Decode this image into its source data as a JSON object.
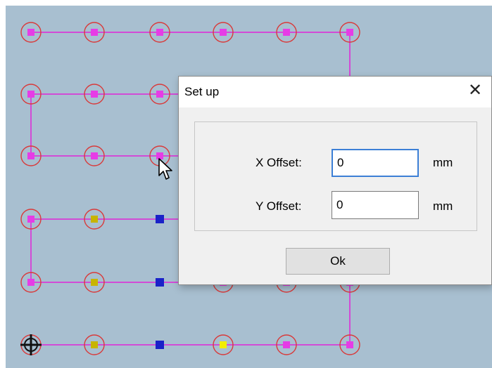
{
  "dialog": {
    "title": "Set up",
    "close_glyph": "✕",
    "x_offset_label": "X Offset:",
    "x_offset_value": "0",
    "x_offset_unit": "mm",
    "y_offset_label": "Y Offset:",
    "y_offset_value": "0",
    "y_offset_unit": "mm",
    "ok_label": "Ok"
  },
  "colors": {
    "background": "#a8bfd0",
    "path": "#d24bd6",
    "ring": "#d93a3a",
    "point_magenta": "#e63ce6",
    "point_yellow": "#c8b400",
    "point_blue": "#1a22c8",
    "point_bright_yellow": "#f2ee00"
  },
  "icons": {
    "cursor": "mouse-pointer-icon",
    "origin": "crosshair-origin-icon"
  }
}
